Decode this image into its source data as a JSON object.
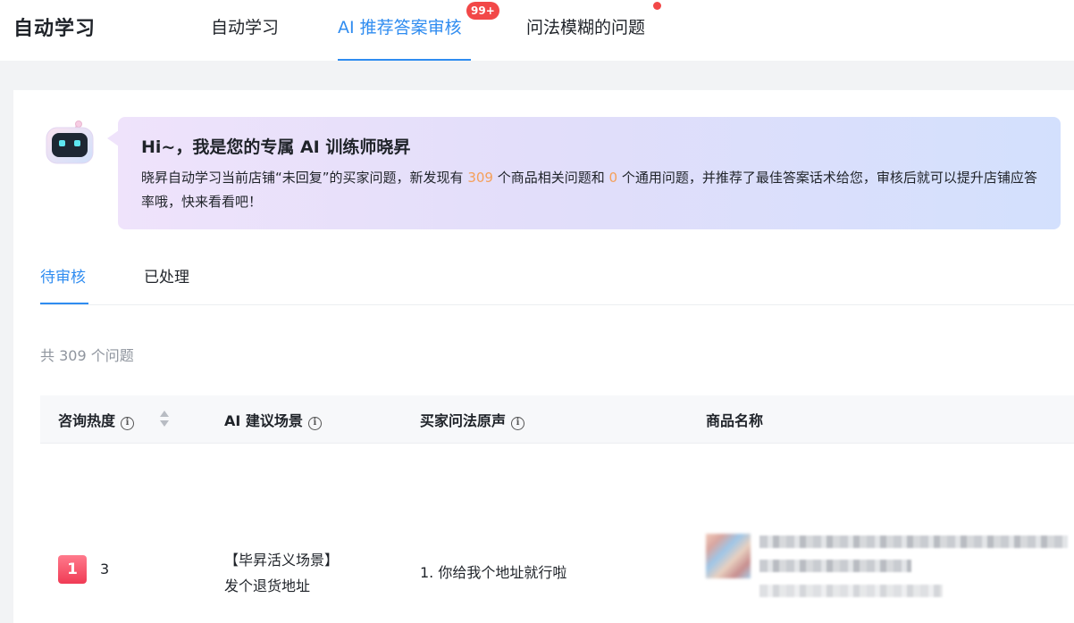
{
  "header": {
    "app_title": "自动学习",
    "tabs": [
      {
        "label": "自动学习",
        "active": false
      },
      {
        "label": "AI 推荐答案审核",
        "active": true,
        "badge": "99+"
      },
      {
        "label": "问法模糊的问题",
        "active": false,
        "dot": true
      }
    ]
  },
  "intro": {
    "robot_icon": "robot-avatar-icon",
    "title": "Hi~，我是您的专属 AI 训练师晓昇",
    "text_before_product_count": "晓昇自动学习当前店铺“未回复”的买家问题，新发现有 ",
    "product_question_count": "309",
    "text_between_counts": " 个商品相关问题和 ",
    "general_question_count": "0",
    "text_after_counts": " 个通用问题，并推荐了最佳答案话术给您，审核后就可以提升店铺应答率哦，快来看看吧！",
    "highlight_color": "#f5a05a"
  },
  "sub_tabs": [
    {
      "label": "待审核",
      "active": true
    },
    {
      "label": "已处理",
      "active": false
    }
  ],
  "summary": {
    "total_text": "共 309 个问题"
  },
  "table": {
    "columns": [
      {
        "label": "咨询热度",
        "info": true,
        "sortable": true
      },
      {
        "label": "AI 建议场景",
        "info": true
      },
      {
        "label": "买家问法原声",
        "info": true
      },
      {
        "label": "商品名称"
      }
    ],
    "rows": [
      {
        "rank": "1",
        "heat": "3",
        "scene_line1": "【毕昇活义场景】",
        "scene_line2": "发个退货地址",
        "buyer_question": "1. 你给我个地址就行啦",
        "product_name_blurred": true
      }
    ]
  },
  "colors": {
    "accent": "#2f8cf0",
    "badge_red": "#f24848",
    "rank_badge": "#f03b55"
  }
}
